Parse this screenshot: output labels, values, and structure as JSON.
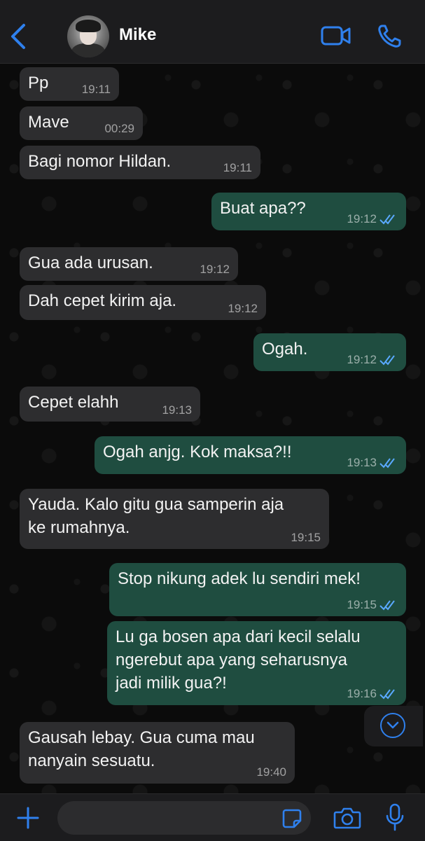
{
  "header": {
    "contact_name": "Mike"
  },
  "messages": [
    {
      "dir": "in",
      "text": "Pp",
      "time": "19:11"
    },
    {
      "dir": "in",
      "text": "Mave",
      "time": "00:29"
    },
    {
      "dir": "in",
      "text": "Bagi nomor Hildan.",
      "time": "19:11"
    },
    {
      "dir": "out",
      "text": "Buat apa??",
      "time": "19:12"
    },
    {
      "dir": "in",
      "text": "Gua ada urusan.",
      "time": "19:12"
    },
    {
      "dir": "in",
      "text": "Dah cepet kirim aja.",
      "time": "19:12"
    },
    {
      "dir": "out",
      "text": "Ogah.",
      "time": "19:12"
    },
    {
      "dir": "in",
      "text": "Cepet elahh",
      "time": "19:13"
    },
    {
      "dir": "out",
      "text": "Ogah anjg. Kok maksa?!!",
      "time": "19:13"
    },
    {
      "dir": "in",
      "text": "Yauda. Kalo gitu gua samperin aja\nke rumahnya.",
      "time": "19:15"
    },
    {
      "dir": "out",
      "text": "Stop nikung adek lu sendiri mek!",
      "time": "19:15"
    },
    {
      "dir": "out",
      "text": "Lu ga bosen apa dari kecil selalu\nngerebut apa yang seharusnya\njadi milik gua?!",
      "time": "19:16"
    },
    {
      "dir": "in",
      "text": "Gausah lebay. Gua cuma mau\nnanyain sesuatu.",
      "time": "19:40"
    }
  ],
  "composer": {
    "value": "",
    "placeholder": ""
  },
  "colors": {
    "accent": "#2f80ed",
    "incoming_bubble": "#2d2d2f",
    "outgoing_bubble": "#1f4d40",
    "read_ticks": "#5aa9ff"
  }
}
